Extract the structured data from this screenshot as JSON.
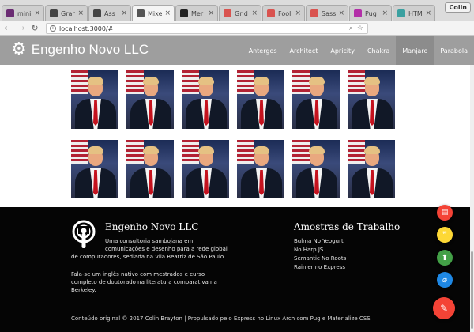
{
  "browser": {
    "tabs": [
      {
        "title": "mini",
        "icon": "m-logo-icon",
        "color": "#6b2c73"
      },
      {
        "title": "Gran",
        "icon": "biohazard-icon",
        "color": "#444444"
      },
      {
        "title": "Ass",
        "icon": "biohazard-icon",
        "color": "#444444"
      },
      {
        "title": "Mixe",
        "icon": "diamond-icon",
        "color": "#555555"
      },
      {
        "title": "Mer",
        "icon": "github-icon",
        "color": "#222222"
      },
      {
        "title": "Grid",
        "icon": "m-logo-icon",
        "color": "#d9534f"
      },
      {
        "title": "Fool",
        "icon": "m-logo-icon",
        "color": "#d9534f"
      },
      {
        "title": "Sass",
        "icon": "m-logo-icon",
        "color": "#d9534f"
      },
      {
        "title": "Pug",
        "icon": "heart-icon",
        "color": "#b32fa8"
      },
      {
        "title": "HTM",
        "icon": "globe-icon",
        "color": "#3aa0a0"
      }
    ],
    "profile": "Colin",
    "url": "localhost:3000/#"
  },
  "navbar": {
    "brand": "Engenho Novo LLC",
    "items": [
      "Antergos",
      "Architect",
      "Apricity",
      "Chakra",
      "Manjaro",
      "Parabola"
    ],
    "selected": "Manjaro"
  },
  "gallery": {
    "rows": 2,
    "cols": 6,
    "alt": "photo"
  },
  "footer": {
    "company": "Engenho Novo LLC",
    "about1": [
      "Uma consultoria sambojana em",
      "comunicações e desenho para a rede global",
      "de computadores, sediada na Vila Beatriz de São Paulo."
    ],
    "about2": [
      "Fala-se um inglês nativo com mestrados e curso",
      "completo de doutorado na literatura comparativa na",
      "Berkeley."
    ],
    "work_title": "Amostras de Trabalho",
    "work_links": [
      "Bulma No Yeogurt",
      "No Harp JS",
      "Semantic No Roots",
      "Rainier no Express"
    ],
    "copyright": "Conteúdo original © 2017 Colin Brayton | Propulsado pelo Express no Linux Arch com Pug e Materialize CSS"
  },
  "fabs": [
    {
      "icon": "chart-icon",
      "color": "#f44336"
    },
    {
      "icon": "quote-icon",
      "color": "#fdd835"
    },
    {
      "icon": "upload-icon",
      "color": "#43a047"
    },
    {
      "icon": "attach-icon",
      "color": "#1e88e5"
    },
    {
      "icon": "edit-icon",
      "color": "#f44336"
    }
  ]
}
